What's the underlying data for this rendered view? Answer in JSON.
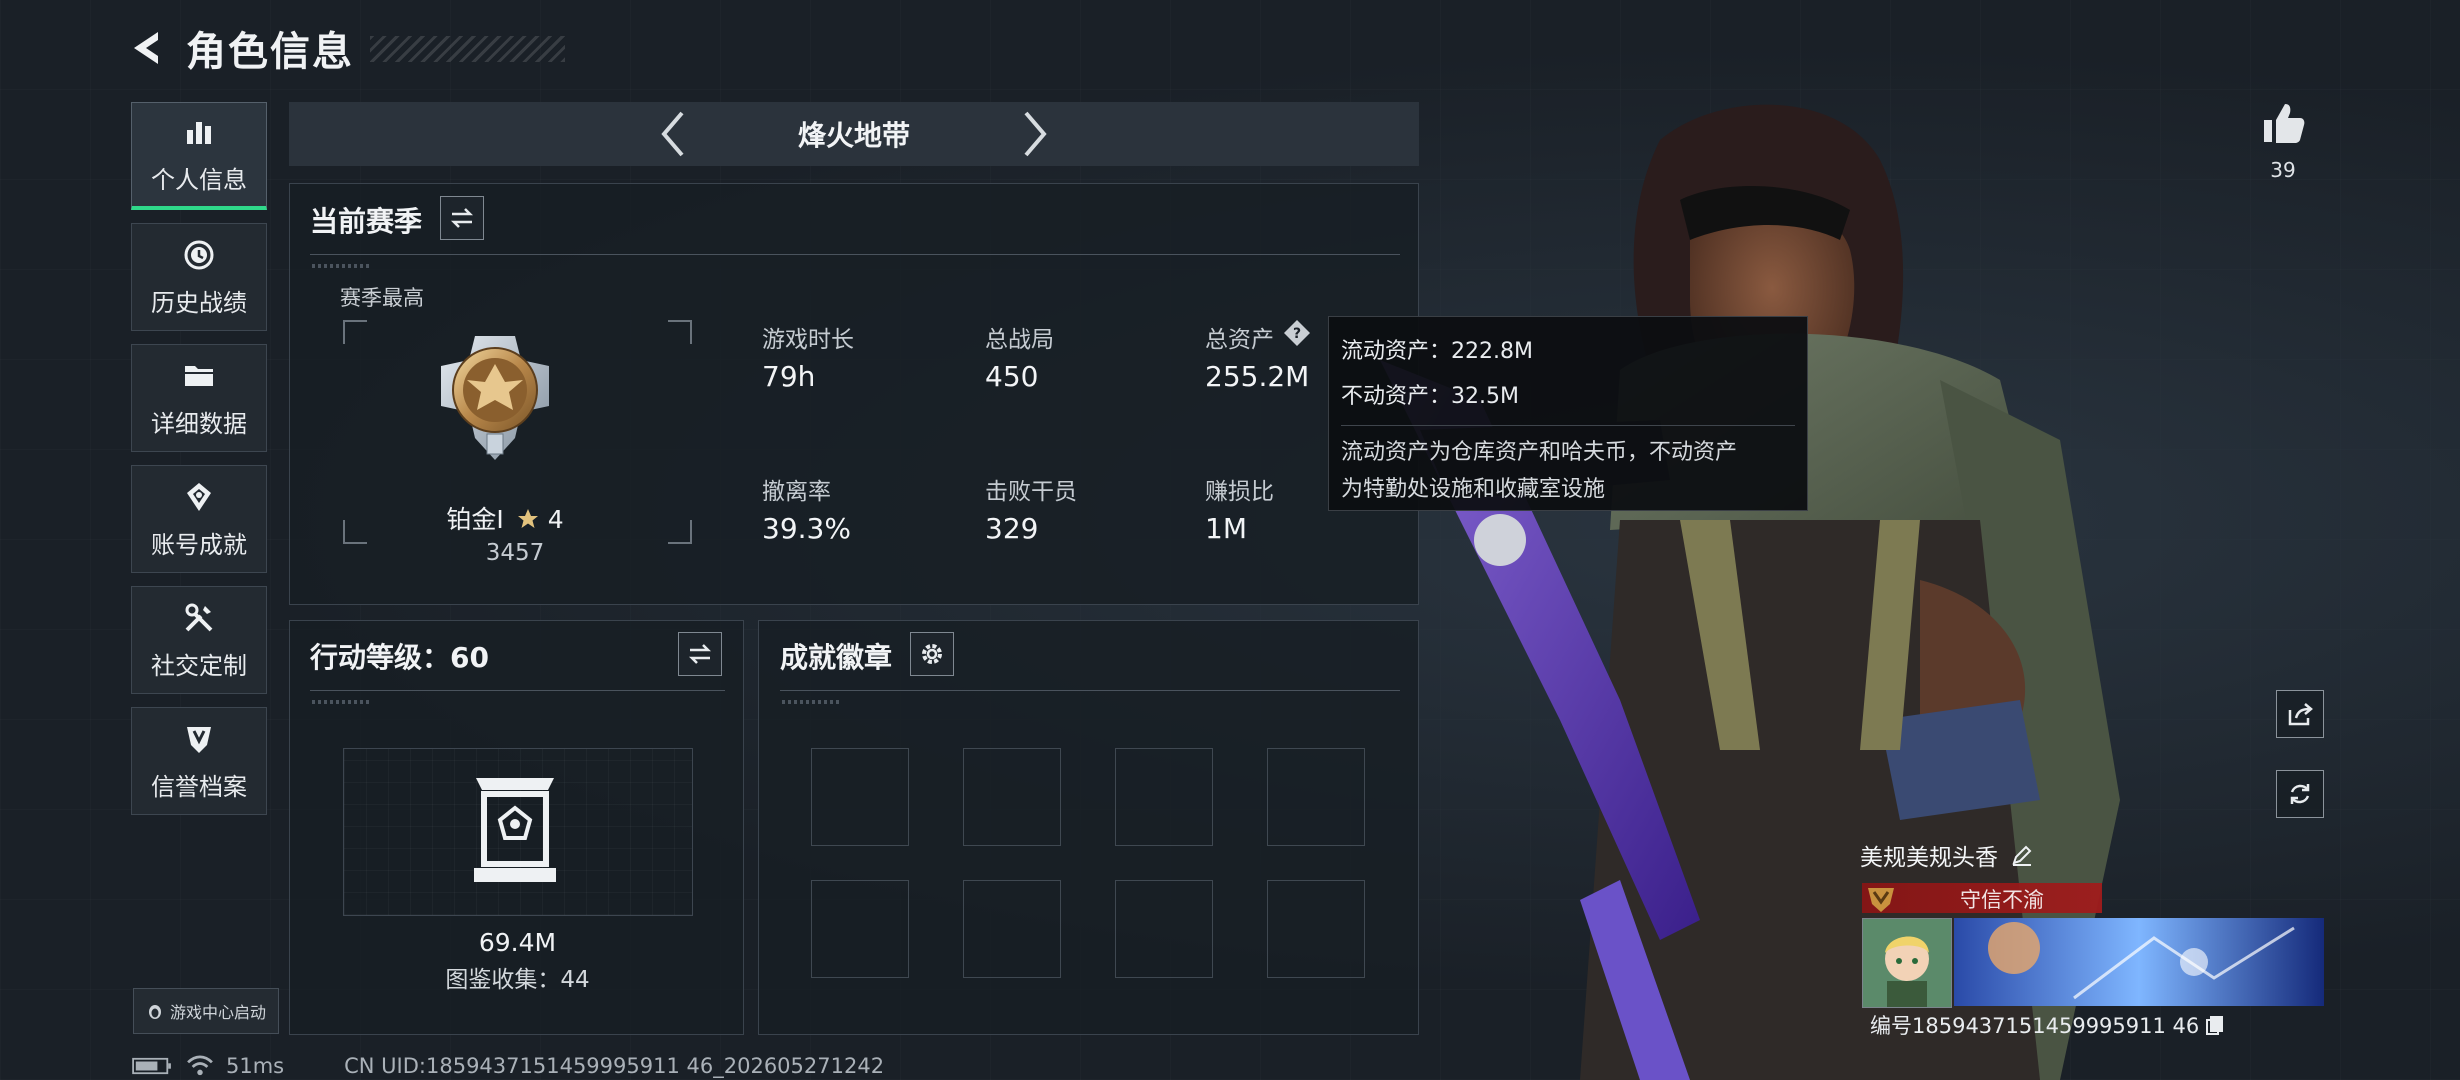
{
  "header": {
    "title": "角色信息"
  },
  "sidebar": {
    "items": [
      {
        "label": "个人信息",
        "icon": "bar-chart-icon",
        "active": true
      },
      {
        "label": "历史战绩",
        "icon": "history-clock-icon"
      },
      {
        "label": "详细数据",
        "icon": "folder-icon"
      },
      {
        "label": "账号成就",
        "icon": "achievement-icon"
      },
      {
        "label": "社交定制",
        "icon": "tools-icon"
      },
      {
        "label": "信誉档案",
        "icon": "shield-badge-icon"
      }
    ],
    "launch_label": "游戏中心启动"
  },
  "mode": {
    "name": "烽火地带"
  },
  "season": {
    "title": "当前赛季",
    "best_label": "赛季最高",
    "rank_name": "铂金I",
    "rank_stars": "4",
    "rank_score": "3457",
    "stats": [
      {
        "label": "游戏时长",
        "value": "79h"
      },
      {
        "label": "总战局",
        "value": "450"
      },
      {
        "label": "总资产",
        "value": "255.2M"
      },
      {
        "label": "撤离率",
        "value": "39.3%"
      },
      {
        "label": "击败干员",
        "value": "329"
      },
      {
        "label": "赚损比",
        "value": "1M"
      }
    ]
  },
  "tooltip": {
    "line1": "流动资产：222.8M",
    "line2": "不动资产：32.5M",
    "desc1": "流动资产为仓库资产和哈夫币，不动资产",
    "desc2": "为特勤处设施和收藏室设施"
  },
  "action_level": {
    "title": "行动等级：60",
    "value": "69.4M",
    "collection": "图鉴收集：44"
  },
  "badges": {
    "title": "成就徽章",
    "slots": 8
  },
  "profile": {
    "likes": "39",
    "name": "美规美规头香",
    "credit": "守信不渝",
    "uid": "编号1859437151459995911 46"
  },
  "status": {
    "ping": "51ms",
    "uid": "CN UID:1859437151459995911 46_202605271242"
  },
  "colors": {
    "accent": "#2fd98a",
    "credit_red": "#a01c1c",
    "bg": "#1a2027"
  }
}
